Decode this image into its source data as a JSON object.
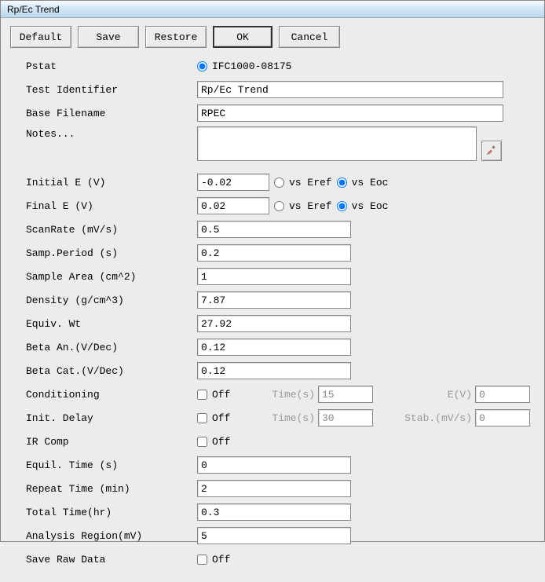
{
  "window": {
    "title": "Rp/Ec Trend"
  },
  "toolbar": {
    "default": "Default",
    "save": "Save",
    "restore": "Restore",
    "ok": "OK",
    "cancel": "Cancel"
  },
  "form": {
    "pstat": {
      "label": "Pstat",
      "option": "IFC1000-08175"
    },
    "test_id": {
      "label": "Test Identifier",
      "value": "Rp/Ec Trend"
    },
    "base_fn": {
      "label": "Base Filename",
      "value": "RPEC"
    },
    "notes": {
      "label": "Notes...",
      "value": "",
      "icon": "edit-icon"
    },
    "initial_e": {
      "label": "Initial E (V)",
      "value": "-0.02",
      "ref_label": "vs Eref",
      "eoc_label": "vs Eoc",
      "selected": "eoc"
    },
    "final_e": {
      "label": "Final E (V)",
      "value": "0.02",
      "ref_label": "vs Eref",
      "eoc_label": "vs Eoc",
      "selected": "eoc"
    },
    "scanrate": {
      "label": "ScanRate (mV/s)",
      "value": "0.5"
    },
    "samp_per": {
      "label": "Samp.Period (s)",
      "value": "0.2"
    },
    "sample_area": {
      "label": "Sample Area (cm^2)",
      "value": "1"
    },
    "density": {
      "label": "Density (g/cm^3)",
      "value": "7.87"
    },
    "equiv_wt": {
      "label": "Equiv. Wt",
      "value": "27.92"
    },
    "beta_an": {
      "label": "Beta An.(V/Dec)",
      "value": "0.12"
    },
    "beta_cat": {
      "label": "Beta Cat.(V/Dec)",
      "value": "0.12"
    },
    "conditioning": {
      "label": "Conditioning",
      "check_label": "Off",
      "checked": false,
      "time_label": "Time(s)",
      "time_value": "15",
      "e_label": "E(V)",
      "e_value": "0"
    },
    "init_delay": {
      "label": "Init. Delay",
      "check_label": "Off",
      "checked": false,
      "time_label": "Time(s)",
      "time_value": "30",
      "stab_label": "Stab.(mV/s)",
      "stab_value": "0"
    },
    "ir_comp": {
      "label": "IR Comp",
      "check_label": "Off",
      "checked": false
    },
    "equil_time": {
      "label": "Equil. Time (s)",
      "value": "0"
    },
    "repeat_time": {
      "label": "Repeat Time (min)",
      "value": "2"
    },
    "total_time": {
      "label": "Total Time(hr)",
      "value": "0.3"
    },
    "analysis_rg": {
      "label": "Analysis Region(mV)",
      "value": "5"
    },
    "save_raw": {
      "label": "Save Raw Data",
      "check_label": "Off",
      "checked": false
    }
  }
}
